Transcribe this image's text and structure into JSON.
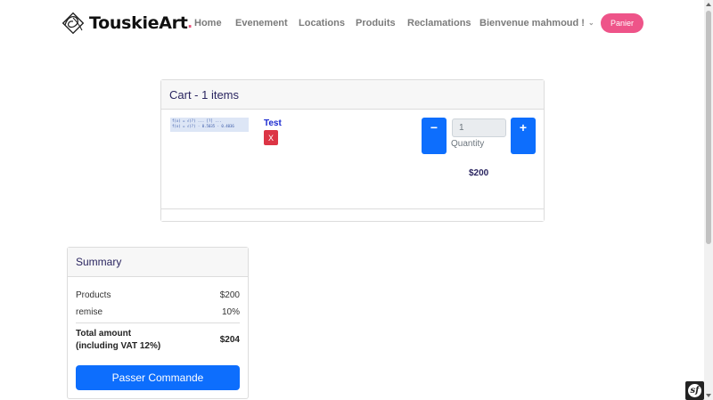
{
  "navbar": {
    "brand": "TouskieArt",
    "brand_dot": ".",
    "items": [
      {
        "label": "Home"
      },
      {
        "label": "Evenement"
      },
      {
        "label": "Locations"
      },
      {
        "label": "Produits"
      },
      {
        "label": "Reclamations"
      },
      {
        "label": "Bienvenue mahmoud !"
      }
    ],
    "cart_button": "Panier",
    "accent_color": "#ee5489"
  },
  "cart": {
    "title": "Cart - 1 items",
    "item": {
      "thumbnail_text": [
        "f(x) = √(?) ... [?] ...",
        "f(x) = √(?) · 0.5035 · 0.4036"
      ],
      "name": "Test",
      "remove_label": "X",
      "decrement_label": "−",
      "increment_label": "+",
      "quantity": "1",
      "quantity_label": "Quantity",
      "price": "$200"
    }
  },
  "summary": {
    "title": "Summary",
    "rows": [
      {
        "label": "Products",
        "value": "$200"
      },
      {
        "label": "remise",
        "value": "10%"
      }
    ],
    "total_label": "Total amount (including VAT 12%)",
    "total_value": "$204",
    "checkout_button": "Passer Commande"
  },
  "colors": {
    "primary": "#0d6efd",
    "danger": "#dc3545",
    "title_text": "#2a2560"
  },
  "icons": {
    "brand_logo": "touskieart-logo-icon",
    "dropdown": "chevron-down-icon",
    "debug_toolbar": "symfony-logo-icon"
  }
}
